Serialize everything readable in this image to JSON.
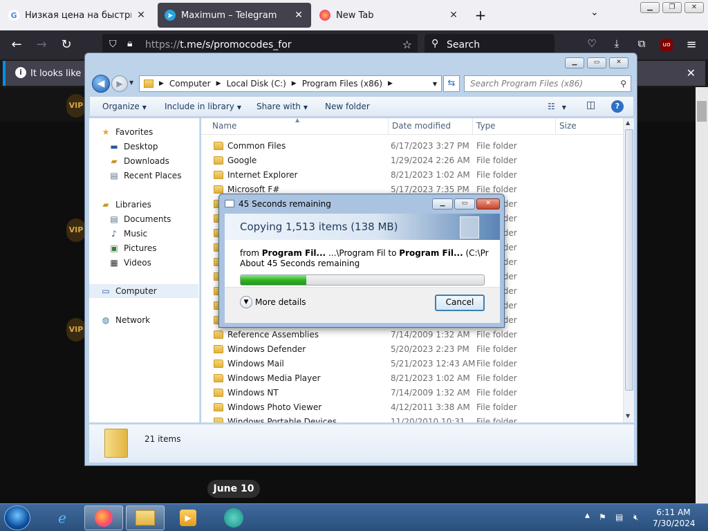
{
  "firefox": {
    "tabs": [
      {
        "title": "Низкая цена на быстрый инте",
        "icon": "google-icon"
      },
      {
        "title": "Maximum – Telegram",
        "icon": "telegram-icon"
      },
      {
        "title": "New Tab",
        "icon": "firefox-icon"
      }
    ],
    "url_prefix": "https://",
    "url_rest": "t.me/s/promocodes_for",
    "search_placeholder": "Search",
    "notification": "It looks like you",
    "addon_badge": "uo"
  },
  "telegram": {
    "date_pill": "June 10",
    "vip": "VIP"
  },
  "explorer": {
    "breadcrumb": [
      "Computer",
      "Local Disk (C:)",
      "Program Files (x86)"
    ],
    "search_placeholder": "Search Program Files (x86)",
    "commands": {
      "organize": "Organize",
      "include": "Include in library",
      "share": "Share with",
      "new_folder": "New folder"
    },
    "nav": {
      "favorites": "Favorites",
      "desktop": "Desktop",
      "downloads": "Downloads",
      "recent": "Recent Places",
      "libraries": "Libraries",
      "documents": "Documents",
      "music": "Music",
      "pictures": "Pictures",
      "videos": "Videos",
      "computer": "Computer",
      "network": "Network"
    },
    "columns": {
      "name": "Name",
      "date": "Date modified",
      "type": "Type",
      "size": "Size"
    },
    "files": [
      {
        "name": "Common Files",
        "date": "6/17/2023 3:27 PM",
        "type": "File folder"
      },
      {
        "name": "Google",
        "date": "1/29/2024 2:26 AM",
        "type": "File folder"
      },
      {
        "name": "Internet Explorer",
        "date": "8/21/2023 1:02 AM",
        "type": "File folder"
      },
      {
        "name": "Microsoft F#",
        "date": "5/17/2023 7:35 PM",
        "type": "File folder"
      },
      {
        "name": "",
        "date": "",
        "type": "File folder"
      },
      {
        "name": "",
        "date": "",
        "type": "File folder"
      },
      {
        "name": "",
        "date": "",
        "type": "File folder"
      },
      {
        "name": "",
        "date": "",
        "type": "File folder"
      },
      {
        "name": "",
        "date": "",
        "type": "File folder"
      },
      {
        "name": "",
        "date": "",
        "type": "File folder"
      },
      {
        "name": "",
        "date": "",
        "type": "File folder"
      },
      {
        "name": "",
        "date": "",
        "type": "File folder"
      },
      {
        "name": "",
        "date": "",
        "type": "File folder"
      },
      {
        "name": "Reference Assemblies",
        "date": "7/14/2009 1:32 AM",
        "type": "File folder"
      },
      {
        "name": "Windows Defender",
        "date": "5/20/2023 2:23 PM",
        "type": "File folder"
      },
      {
        "name": "Windows Mail",
        "date": "5/21/2023 12:43 AM",
        "type": "File folder"
      },
      {
        "name": "Windows Media Player",
        "date": "8/21/2023 1:02 AM",
        "type": "File folder"
      },
      {
        "name": "Windows NT",
        "date": "7/14/2009 1:32 AM",
        "type": "File folder"
      },
      {
        "name": "Windows Photo Viewer",
        "date": "4/12/2011 3:38 AM",
        "type": "File folder"
      },
      {
        "name": "Windows Portable Devices",
        "date": "11/20/2010 10:31",
        "type": "File folder"
      }
    ],
    "item_count": "21 items"
  },
  "copy_dialog": {
    "title": "45 Seconds remaining",
    "heading": "Copying 1,513 items (138 MB)",
    "from_label": "from",
    "from_source": "Program Fil...",
    "from_path": "...\\Program Fil",
    "to_label": "to",
    "to_dest": "Program Fil...",
    "to_path": "(C:\\Program F",
    "about": "About 45 Seconds remaining",
    "progress_percent": 27,
    "more_details": "More details",
    "cancel": "Cancel"
  },
  "taskbar": {
    "time": "6:11 AM",
    "date": "7/30/2024"
  }
}
